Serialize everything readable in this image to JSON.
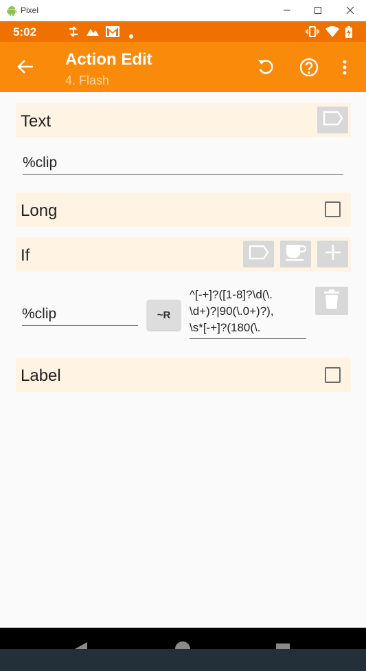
{
  "window": {
    "title": "Pixel"
  },
  "statusbar": {
    "time": "5:02"
  },
  "appbar": {
    "title": "Action Edit",
    "subtitle": "4. Flash"
  },
  "sections": {
    "text": {
      "label": "Text",
      "value": "%clip"
    },
    "long": {
      "label": "Long"
    },
    "if": {
      "label": "If",
      "left_value": "%clip",
      "operator_label": "~R",
      "right_value": "^[-+]?([1-8]?\\d(\\.\n\\d+)?|90(\\.0+)?),\n\\s*[-+]?(180(\\."
    },
    "label": {
      "label": "Label"
    }
  },
  "colors": {
    "statusbar": "#ef7100",
    "appbar": "#f98a0a",
    "section_bg": "#fff3e4",
    "button_bg": "#d8d8d8"
  }
}
